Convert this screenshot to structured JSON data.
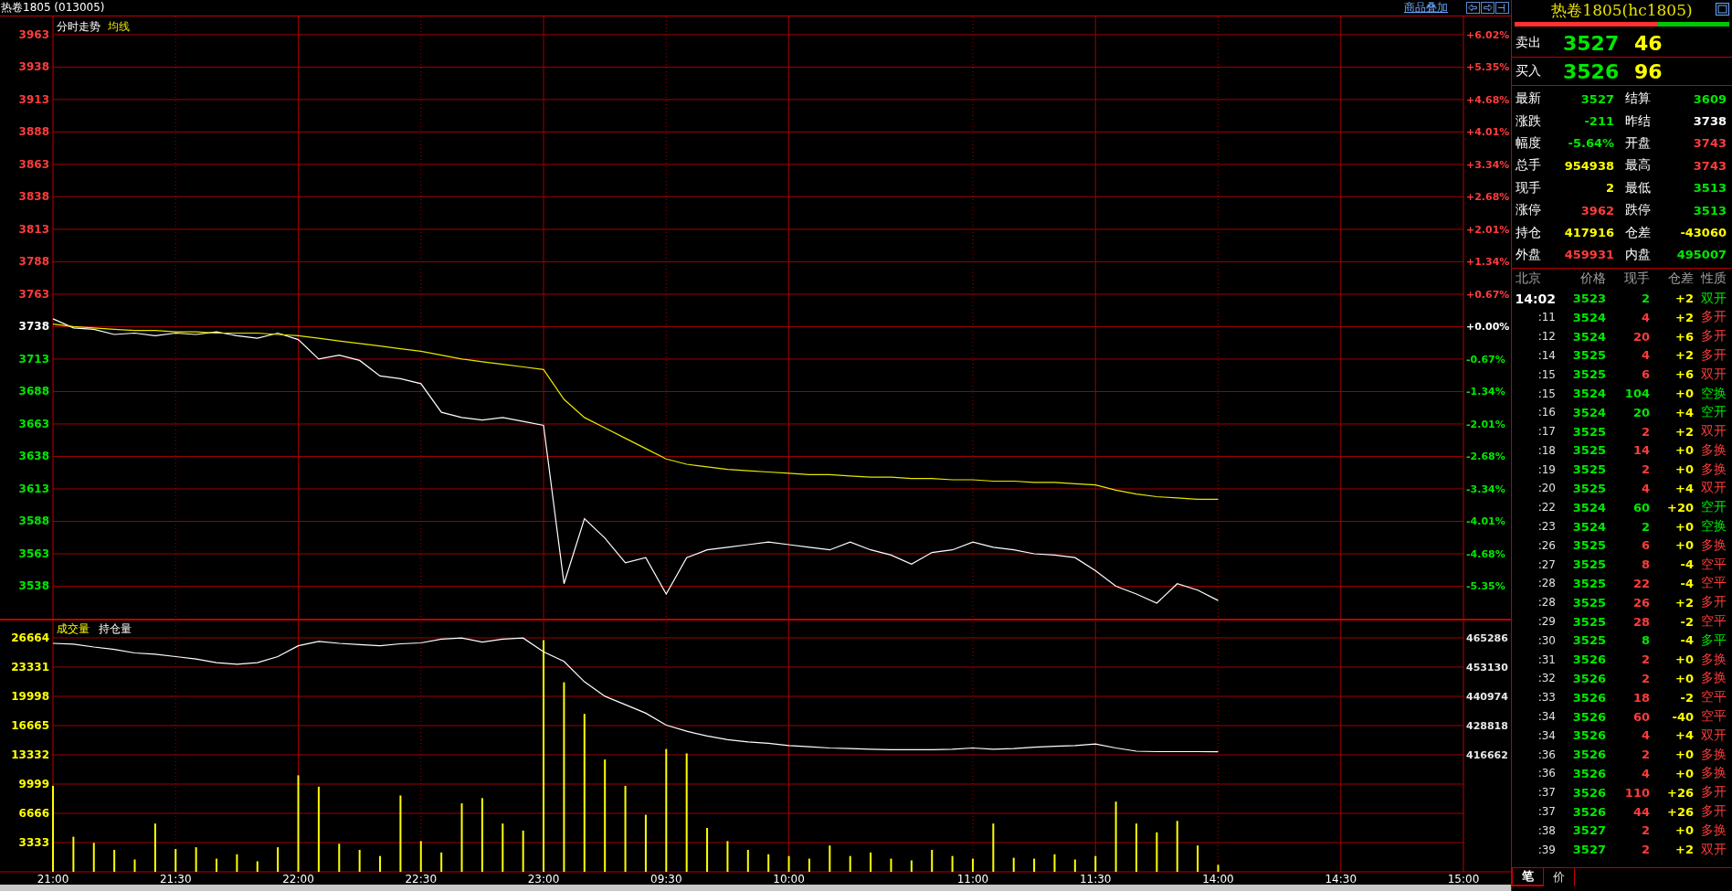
{
  "title_bar": {
    "title": "热卷1805 (013005)",
    "overlay_link": "商品叠加"
  },
  "price_chart": {
    "chart_data": {
      "type": "line",
      "title": "分时走势",
      "categories": [
        null,
        null,
        null,
        null,
        null,
        null,
        null,
        null,
        null,
        null,
        null,
        null,
        null,
        null,
        null,
        null,
        null,
        null,
        null,
        null,
        null,
        null,
        null,
        null,
        null,
        null,
        null,
        null,
        null,
        null,
        null,
        null,
        null,
        null,
        null,
        null,
        null,
        null,
        null,
        null,
        null,
        null,
        null,
        null,
        null,
        null,
        null,
        null,
        null,
        null,
        null,
        null,
        null,
        null,
        null,
        null,
        null,
        null,
        null,
        null,
        null,
        null,
        null,
        null,
        null,
        null,
        null,
        null,
        null,
        null
      ],
      "ylim": [
        3513,
        3977
      ],
      "yticks": [
        3963,
        3938,
        3913,
        3888,
        3863,
        3838,
        3813,
        3788,
        3763,
        3738,
        3713,
        3688,
        3663,
        3638,
        3613,
        3588,
        3563,
        3538
      ],
      "grid": true,
      "series": [
        {
          "color": "#ffffff",
          "values": [
            3744,
            3737,
            3736,
            3732,
            3733,
            3731,
            3733,
            3732,
            3734,
            3731,
            3729,
            3733,
            3728,
            3713,
            3716,
            3712,
            3700,
            3698,
            3694,
            3672,
            3668,
            3666,
            3668,
            3665,
            3662,
            3540,
            3590,
            3575,
            3556,
            3560,
            3532,
            3560,
            3566,
            3568,
            3570,
            3572,
            3570,
            3568,
            3566,
            3572,
            3566,
            3562,
            3555,
            3564,
            3566,
            3572,
            3568,
            3566,
            3563,
            3562,
            3560,
            3550,
            3538,
            3532,
            3525,
            3540,
            3535,
            3527,
            null,
            null,
            null,
            null,
            null,
            null,
            null,
            null,
            null,
            null,
            null,
            null
          ]
        },
        {
          "name": "均线",
          "color": "#e8e800",
          "values": [
            3740,
            3738,
            3737,
            3736,
            3735,
            3735,
            3734,
            3734,
            3733,
            3733,
            3733,
            3732,
            3731,
            3729,
            3727,
            3725,
            3723,
            3721,
            3719,
            3716,
            3713,
            3711,
            3709,
            3707,
            3705,
            3682,
            3668,
            3660,
            3652,
            3644,
            3636,
            3632,
            3630,
            3628,
            3627,
            3626,
            3625,
            3624,
            3624,
            3623,
            3622,
            3622,
            3621,
            3621,
            3620,
            3620,
            3619,
            3619,
            3618,
            3618,
            3617,
            3616,
            3612,
            3609,
            3607,
            3606,
            3605,
            3605,
            null,
            null,
            null,
            null,
            null,
            null,
            null,
            null,
            null,
            null,
            null,
            null
          ]
        }
      ]
    },
    "percent_axis": [
      {
        "label": "+6.02%",
        "color": "#ff3c3c"
      },
      {
        "label": "+5.35%",
        "color": "#ff3c3c"
      },
      {
        "label": "+4.68%",
        "color": "#ff3c3c"
      },
      {
        "label": "+4.01%",
        "color": "#ff3c3c"
      },
      {
        "label": "+3.34%",
        "color": "#ff3c3c"
      },
      {
        "label": "+2.68%",
        "color": "#ff3c3c"
      },
      {
        "label": "+2.01%",
        "color": "#ff3c3c"
      },
      {
        "label": "+1.34%",
        "color": "#ff3c3c"
      },
      {
        "label": "+0.67%",
        "color": "#ff3c3c"
      },
      {
        "label": "+0.00%",
        "color": "#ffffff"
      },
      {
        "label": "-0.67%",
        "color": "#00e800"
      },
      {
        "label": "-1.34%",
        "color": "#00e800"
      },
      {
        "label": "-2.01%",
        "color": "#00e800"
      },
      {
        "label": "-2.68%",
        "color": "#00e800"
      },
      {
        "label": "-3.34%",
        "color": "#00e800"
      },
      {
        "label": "-4.01%",
        "color": "#00e800"
      },
      {
        "label": "-4.68%",
        "color": "#00e800"
      },
      {
        "label": "-5.35%",
        "color": "#00e800"
      }
    ]
  },
  "volume_chart": {
    "chart_data": {
      "type": "bar",
      "categories": [
        "21:00",
        null,
        null,
        null,
        null,
        null,
        "21:30",
        null,
        null,
        null,
        null,
        null,
        "22:00",
        null,
        null,
        null,
        null,
        null,
        "22:30",
        null,
        null,
        null,
        null,
        null,
        "23:00",
        null,
        null,
        null,
        null,
        null,
        "09:30",
        null,
        null,
        null,
        null,
        null,
        "10:00",
        null,
        null,
        null,
        null,
        null,
        null,
        null,
        null,
        "11:00",
        null,
        null,
        null,
        null,
        null,
        "11:30",
        null,
        null,
        null,
        null,
        null,
        "14:00",
        null,
        null,
        null,
        null,
        null,
        "14:30",
        null,
        null,
        null,
        null,
        null,
        "15:00"
      ],
      "ylim": [
        0,
        28851
      ],
      "grid": true,
      "yticks": [
        26664,
        23331,
        19998,
        16665,
        13332,
        9999,
        6666,
        3333
      ],
      "series": [
        {
          "name": "成交量",
          "color": "#ffff00",
          "values": [
            9800,
            4000,
            3300,
            2500,
            1400,
            5500,
            2600,
            2800,
            1500,
            2000,
            1200,
            2800,
            11000,
            9700,
            3200,
            2500,
            1800,
            8700,
            3500,
            2200,
            7800,
            8400,
            5500,
            4700,
            26400,
            21600,
            18000,
            12800,
            9800,
            6500,
            14000,
            13500,
            5000,
            3500,
            2500,
            2000,
            1800,
            1500,
            3000,
            1800,
            2200,
            1500,
            1300,
            2500,
            1800,
            1500,
            5500,
            1600,
            1500,
            2000,
            1400,
            1800,
            8000,
            5500,
            4500,
            5800,
            3000,
            800,
            null,
            null,
            null,
            null,
            null,
            null,
            null,
            null,
            null,
            null,
            null,
            null
          ]
        }
      ]
    }
  },
  "open_interest_chart": {
    "chart_data": {
      "type": "line",
      "categories": [
        null,
        null,
        null,
        null,
        null,
        null,
        null,
        null,
        null,
        null,
        null,
        null,
        null,
        null,
        null,
        null,
        null,
        null,
        null,
        null,
        null,
        null,
        null,
        null,
        null,
        null,
        null,
        null,
        null,
        null,
        null,
        null,
        null,
        null,
        null,
        null,
        null,
        null,
        null,
        null,
        null,
        null,
        null,
        null,
        null,
        null,
        null,
        null,
        null,
        null,
        null,
        null,
        null,
        null,
        null,
        null,
        null,
        null,
        null,
        null,
        null,
        null,
        null,
        null,
        null,
        null,
        null,
        null,
        null,
        null
      ],
      "ylim": [
        416662,
        465286
      ],
      "yticks": [
        465286,
        453130,
        440974,
        428818,
        416662
      ],
      "series": [
        {
          "name": "持仓量",
          "color": "#ffffff",
          "values": [
            463000,
            462700,
            461500,
            460500,
            459000,
            458500,
            457500,
            456500,
            455000,
            454300,
            455000,
            457500,
            462000,
            463800,
            463000,
            462500,
            462000,
            462800,
            463200,
            464800,
            465200,
            463500,
            464800,
            465200,
            459500,
            455500,
            447000,
            441000,
            437500,
            434000,
            429000,
            426500,
            424500,
            423000,
            422000,
            421500,
            420500,
            420000,
            419500,
            419300,
            419000,
            418800,
            418800,
            418800,
            419000,
            419500,
            419000,
            419300,
            419800,
            420200,
            420500,
            421200,
            419500,
            418200,
            418000,
            418000,
            418000,
            417900,
            null,
            null,
            null,
            null,
            null,
            null,
            null,
            null,
            null,
            null,
            null,
            null
          ]
        }
      ]
    }
  },
  "quote_panel": {
    "title": "热卷1805(hc1805)",
    "ratio_bar": {
      "level": 0.67
    },
    "order_book": [
      {
        "label": "卖出",
        "price": "3527",
        "volume": "46",
        "color": "#00e800"
      },
      {
        "label": "买入",
        "price": "3526",
        "volume": "96",
        "color": "#00e800"
      }
    ],
    "stats": [
      {
        "label": "最新",
        "value": "3527",
        "color": "#00e800"
      },
      {
        "label": "结算",
        "value": "3609",
        "color": "#00e800"
      },
      {
        "label": "涨跌",
        "value": "-211",
        "color": "#00e800"
      },
      {
        "label": "昨结",
        "value": "3738",
        "color": "#ffffff"
      },
      {
        "label": "幅度",
        "value": "-5.64%",
        "color": "#00e800"
      },
      {
        "label": "开盘",
        "value": "3743",
        "color": "#ff3c3c"
      },
      {
        "label": "总手",
        "value": "954938",
        "color": "#ffff00"
      },
      {
        "label": "最高",
        "value": "3743",
        "color": "#ff3c3c"
      },
      {
        "label": "现手",
        "value": "2",
        "color": "#ffff00"
      },
      {
        "label": "最低",
        "value": "3513",
        "color": "#00e800"
      },
      {
        "label": "涨停",
        "value": "3962",
        "color": "#ff3c3c"
      },
      {
        "label": "跌停",
        "value": "3513",
        "color": "#00e800"
      },
      {
        "label": "持仓",
        "value": "417916",
        "color": "#ffff00"
      },
      {
        "label": "仓差",
        "value": "-43060",
        "color": "#ffff00"
      },
      {
        "label": "外盘",
        "value": "459931",
        "color": "#ff3c3c"
      },
      {
        "label": "内盘",
        "value": "495007",
        "color": "#00e800"
      }
    ]
  },
  "trades": {
    "columns": [
      "北京",
      "价格",
      "现手",
      "仓差",
      "性质"
    ],
    "color": "#00e800",
    "rows": [
      {
        "time": "14:02",
        "kind": "full",
        "price": "3523",
        "volume": "2",
        "oi_change": "+2",
        "nature": "双开",
        "color": "#00e800"
      },
      {
        "time": ":11",
        "kind": "minute",
        "price": "3524",
        "volume": "4",
        "oi_change": "+2",
        "nature": "多开",
        "color": "#ff3c3c"
      },
      {
        "time": ":12",
        "kind": "minute",
        "price": "3524",
        "volume": "20",
        "oi_change": "+6",
        "nature": "多开",
        "color": "#ff3c3c"
      },
      {
        "time": ":14",
        "kind": "minute",
        "price": "3525",
        "volume": "4",
        "oi_change": "+2",
        "nature": "多开",
        "color": "#ff3c3c"
      },
      {
        "time": ":15",
        "kind": "minute",
        "price": "3525",
        "volume": "6",
        "oi_change": "+6",
        "nature": "双开",
        "color": "#ff3c3c"
      },
      {
        "time": ":15",
        "kind": "minute",
        "price": "3524",
        "volume": "104",
        "oi_change": "+0",
        "nature": "空换",
        "color": "#00e800"
      },
      {
        "time": ":16",
        "kind": "minute",
        "price": "3524",
        "volume": "20",
        "oi_change": "+4",
        "nature": "空开",
        "color": "#00e800"
      },
      {
        "time": ":17",
        "kind": "minute",
        "price": "3525",
        "volume": "2",
        "oi_change": "+2",
        "nature": "双开",
        "color": "#ff3c3c"
      },
      {
        "time": ":18",
        "kind": "minute",
        "price": "3525",
        "volume": "14",
        "oi_change": "+0",
        "nature": "多换",
        "color": "#ff3c3c"
      },
      {
        "time": ":19",
        "kind": "minute",
        "price": "3525",
        "volume": "2",
        "oi_change": "+0",
        "nature": "多换",
        "color": "#ff3c3c"
      },
      {
        "time": ":20",
        "kind": "minute",
        "price": "3525",
        "volume": "4",
        "oi_change": "+4",
        "nature": "双开",
        "color": "#ff3c3c"
      },
      {
        "time": ":22",
        "kind": "minute",
        "price": "3524",
        "volume": "60",
        "oi_change": "+20",
        "nature": "空开",
        "color": "#00e800"
      },
      {
        "time": ":23",
        "kind": "minute",
        "price": "3524",
        "volume": "2",
        "oi_change": "+0",
        "nature": "空换",
        "color": "#00e800"
      },
      {
        "time": ":26",
        "kind": "minute",
        "price": "3525",
        "volume": "6",
        "oi_change": "+0",
        "nature": "多换",
        "color": "#ff3c3c"
      },
      {
        "time": ":27",
        "kind": "minute",
        "price": "3525",
        "volume": "8",
        "oi_change": "-4",
        "nature": "空平",
        "color": "#ff3c3c"
      },
      {
        "time": ":28",
        "kind": "minute",
        "price": "3525",
        "volume": "22",
        "oi_change": "-4",
        "nature": "空平",
        "color": "#ff3c3c"
      },
      {
        "time": ":28",
        "kind": "minute",
        "price": "3525",
        "volume": "26",
        "oi_change": "+2",
        "nature": "多开",
        "color": "#ff3c3c"
      },
      {
        "time": ":29",
        "kind": "minute",
        "price": "3525",
        "volume": "28",
        "oi_change": "-2",
        "nature": "空平",
        "color": "#ff3c3c"
      },
      {
        "time": ":30",
        "kind": "minute",
        "price": "3525",
        "volume": "8",
        "oi_change": "-4",
        "nature": "多平",
        "color": "#00e800"
      },
      {
        "time": ":31",
        "kind": "minute",
        "price": "3526",
        "volume": "2",
        "oi_change": "+0",
        "nature": "多换",
        "color": "#ff3c3c"
      },
      {
        "time": ":32",
        "kind": "minute",
        "price": "3526",
        "volume": "2",
        "oi_change": "+0",
        "nature": "多换",
        "color": "#ff3c3c"
      },
      {
        "time": ":33",
        "kind": "minute",
        "price": "3526",
        "volume": "18",
        "oi_change": "-2",
        "nature": "空平",
        "color": "#ff3c3c"
      },
      {
        "time": ":34",
        "kind": "minute",
        "price": "3526",
        "volume": "60",
        "oi_change": "-40",
        "nature": "空平",
        "color": "#ff3c3c"
      },
      {
        "time": ":34",
        "kind": "minute",
        "price": "3526",
        "volume": "4",
        "oi_change": "+4",
        "nature": "双开",
        "color": "#ff3c3c"
      },
      {
        "time": ":36",
        "kind": "minute",
        "price": "3526",
        "volume": "2",
        "oi_change": "+0",
        "nature": "多换",
        "color": "#ff3c3c"
      },
      {
        "time": ":36",
        "kind": "minute",
        "price": "3526",
        "volume": "4",
        "oi_change": "+0",
        "nature": "多换",
        "color": "#ff3c3c"
      },
      {
        "time": ":37",
        "kind": "minute",
        "price": "3526",
        "volume": "110",
        "oi_change": "+26",
        "nature": "多开",
        "color": "#ff3c3c"
      },
      {
        "time": ":37",
        "kind": "minute",
        "price": "3526",
        "volume": "44",
        "oi_change": "+26",
        "nature": "多开",
        "color": "#ff3c3c"
      },
      {
        "time": ":38",
        "kind": "minute",
        "price": "3527",
        "volume": "2",
        "oi_change": "+0",
        "nature": "多换",
        "color": "#ff3c3c"
      },
      {
        "time": ":39",
        "kind": "minute",
        "price": "3527",
        "volume": "2",
        "oi_change": "+2",
        "nature": "双开",
        "color": "#ff3c3c"
      }
    ]
  },
  "bottom_tabs": [
    {
      "label": "笔",
      "selected": true
    },
    {
      "label": "价",
      "selected": false
    }
  ]
}
